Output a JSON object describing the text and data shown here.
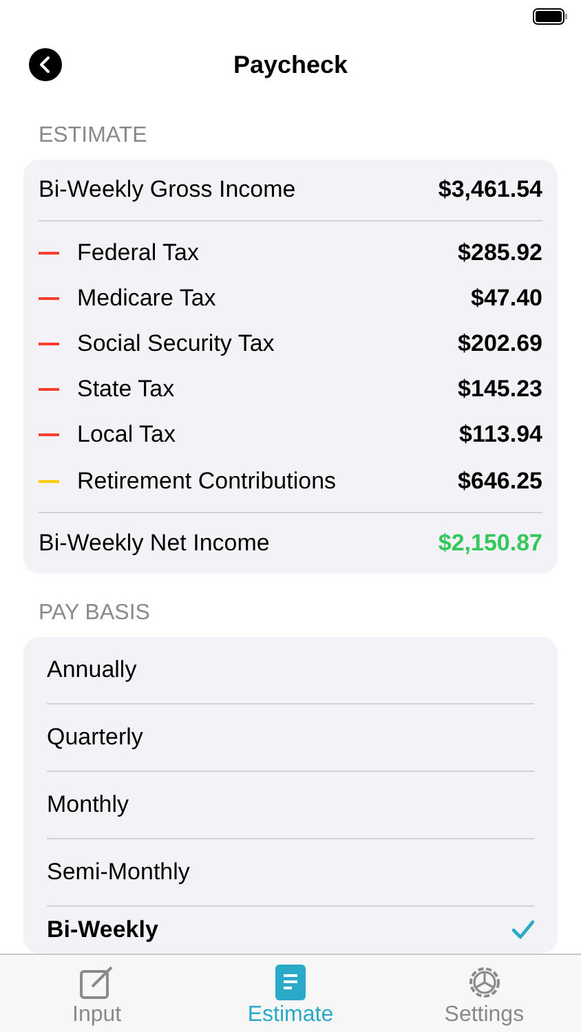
{
  "nav": {
    "title": "Paycheck"
  },
  "estimate": {
    "header": "ESTIMATE",
    "gross": {
      "label": "Bi-Weekly Gross Income",
      "value": "$3,461.54"
    },
    "deductions": [
      {
        "label": "Federal Tax",
        "value": "$285.92",
        "color": "#ff3b30"
      },
      {
        "label": "Medicare Tax",
        "value": "$47.40",
        "color": "#ff3b30"
      },
      {
        "label": "Social Security Tax",
        "value": "$202.69",
        "color": "#ff3b30"
      },
      {
        "label": "State Tax",
        "value": "$145.23",
        "color": "#ff3b30"
      },
      {
        "label": "Local Tax",
        "value": "$113.94",
        "color": "#ff3b30"
      },
      {
        "label": "Retirement Contributions",
        "value": "$646.25",
        "color": "#ffcc00"
      }
    ],
    "net": {
      "label": "Bi-Weekly Net Income",
      "value": "$2,150.87"
    }
  },
  "pay_basis": {
    "header": "PAY BASIS",
    "options": [
      {
        "label": "Annually",
        "selected": false
      },
      {
        "label": "Quarterly",
        "selected": false
      },
      {
        "label": "Monthly",
        "selected": false
      },
      {
        "label": "Semi-Monthly",
        "selected": false
      },
      {
        "label": "Bi-Weekly",
        "selected": true
      }
    ]
  },
  "tab_bar": [
    {
      "label": "Input",
      "kind": "input",
      "selected": false
    },
    {
      "label": "Estimate",
      "kind": "estimate",
      "selected": true
    },
    {
      "label": "Settings",
      "kind": "settings",
      "selected": false
    }
  ]
}
